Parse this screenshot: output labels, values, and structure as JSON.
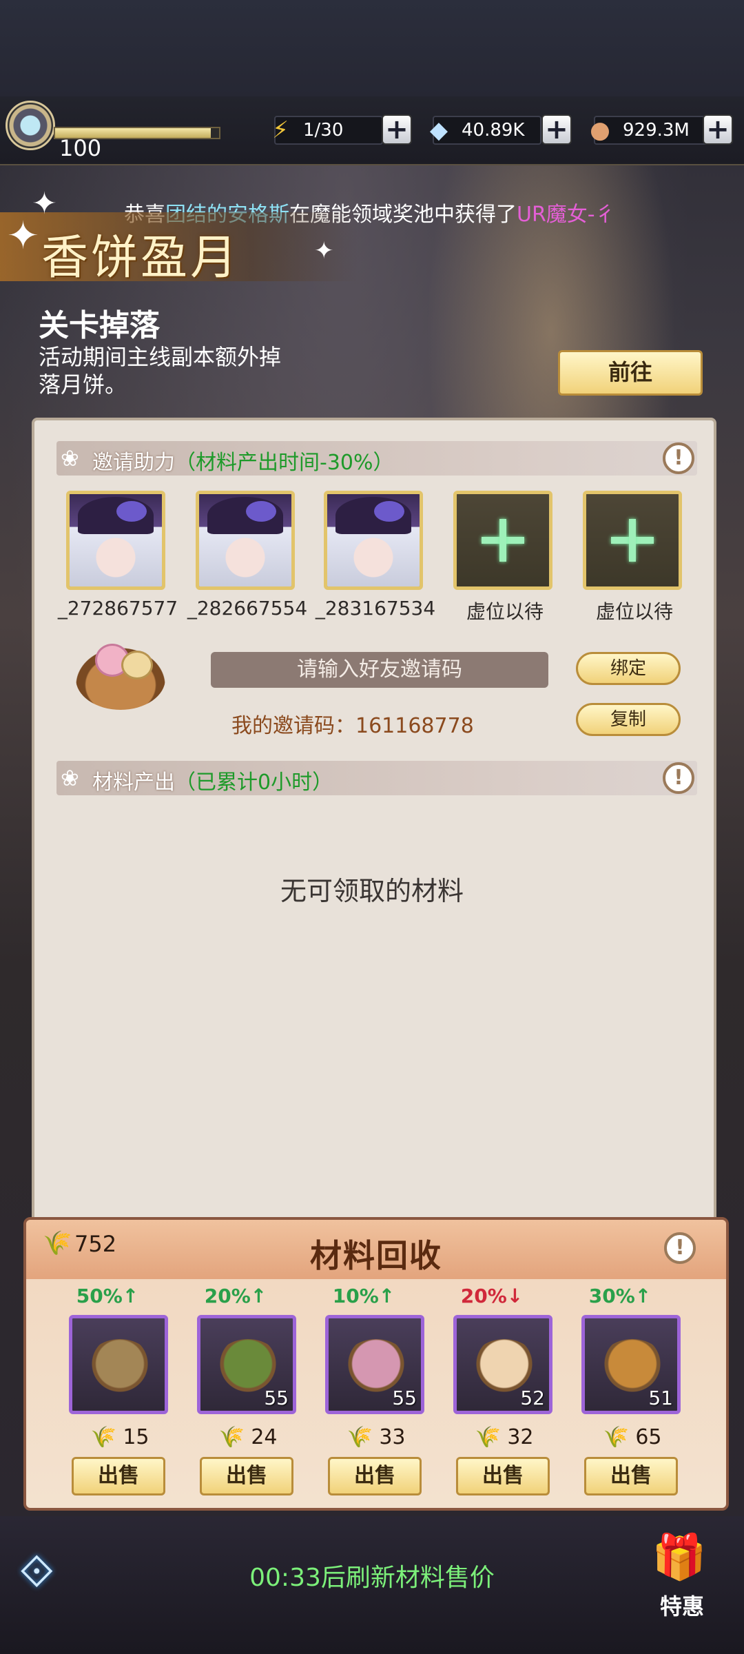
{
  "hud": {
    "level": "100",
    "level_progress": 0.95,
    "stamina": "1/30",
    "diamonds": "40.89K",
    "gold": "929.3M",
    "icons": {
      "stamina": "lightning-icon",
      "diamonds": "diamond-icon",
      "gold": "coin-icon",
      "plus": "plus-icon"
    }
  },
  "marquee": {
    "prefix": "恭喜",
    "player": "团结的安格斯",
    "mid": "在魔能领域奖池中获得了",
    "reward": "UR魔女-彳"
  },
  "event": {
    "title": "香饼盈月"
  },
  "stage_drop": {
    "title": "关卡掉落",
    "desc": "活动期间主线副本额外掉落月饼。",
    "goto": "前往"
  },
  "invite": {
    "label": "邀请助力",
    "sub": "（材料产出时间-30%）",
    "slots": [
      {
        "name": "_272867577",
        "filled": true
      },
      {
        "name": "_282667554",
        "filled": true
      },
      {
        "name": "_283167534",
        "filled": true
      },
      {
        "name": "虚位以待",
        "filled": false
      },
      {
        "name": "虚位以待",
        "filled": false
      }
    ],
    "input_placeholder": "请输入好友邀请码",
    "my_code_label": "我的邀请码：161168778",
    "bind": "绑定",
    "copy": "复制"
  },
  "material_output": {
    "label": "材料产出",
    "sub": "（已累计0小时）",
    "empty_text": "无可领取的材料"
  },
  "recycle": {
    "title": "材料回收",
    "total": "752",
    "items": [
      {
        "pct": "50%↑",
        "trend": "up",
        "qty": "",
        "price": "15",
        "sell": "出售",
        "color": "#a38656"
      },
      {
        "pct": "20%↑",
        "trend": "up",
        "qty": "55",
        "price": "24",
        "sell": "出售",
        "color": "#6a8a3a"
      },
      {
        "pct": "10%↑",
        "trend": "up",
        "qty": "55",
        "price": "33",
        "sell": "出售",
        "color": "#d597b1"
      },
      {
        "pct": "20%↓",
        "trend": "down",
        "qty": "52",
        "price": "32",
        "sell": "出售",
        "color": "#efd4b0"
      },
      {
        "pct": "30%↑",
        "trend": "up",
        "qty": "51",
        "price": "65",
        "sell": "出售",
        "color": "#c88a3a"
      }
    ]
  },
  "footer": {
    "refresh_text": "00:33后刷新材料售价",
    "gift_label": "特惠"
  }
}
